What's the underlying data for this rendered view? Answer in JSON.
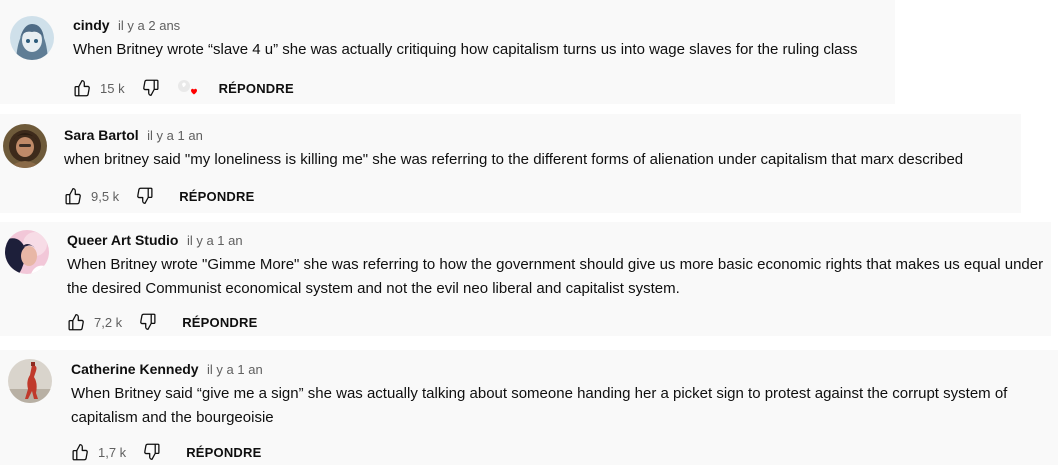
{
  "comments": [
    {
      "author": "cindy",
      "time": "il y a 2 ans",
      "text": "When Britney wrote “slave 4 u” she was actually critiquing how capitalism turns us into wage slaves for the ruling class",
      "likes": "15 k",
      "reply_label": "RÉPONDRE",
      "hearted": true
    },
    {
      "author": "Sara Bartol",
      "time": "il y a 1 an",
      "text": "when britney said \"my loneliness is killing me\" she was referring to the different forms of alienation under capitalism that marx described",
      "likes": "9,5 k",
      "reply_label": "RÉPONDRE"
    },
    {
      "author": "Queer Art Studio",
      "time": "il y a 1 an",
      "text": "When Britney wrote \"Gimme More\" she was referring to how the government should give us more basic economic rights that makes us equal under the desired Communist economical system and not the evil neo liberal and capitalist system.",
      "likes": "7,2 k",
      "reply_label": "RÉPONDRE"
    },
    {
      "author": "Catherine Kennedy",
      "time": "il y a 1 an",
      "text": "When Britney said “give me a sign” she was actually talking about someone handing her a picket sign to protest against the corrupt system of capitalism and the bourgeoisie",
      "likes": "1,7 k",
      "reply_label": "RÉPONDRE"
    }
  ],
  "colors": {
    "heart": "#ff0000",
    "background": "#f9f9f9"
  },
  "icons": {
    "like": "thumb-up-icon",
    "dislike": "thumb-down-icon",
    "heart": "heart-icon"
  }
}
